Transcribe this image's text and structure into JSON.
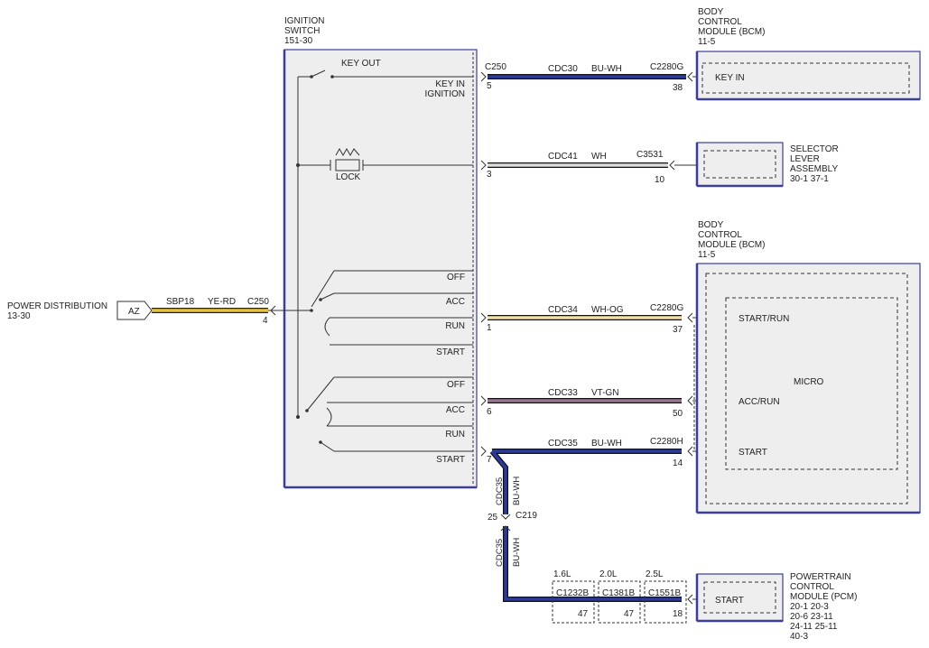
{
  "ignition_switch": {
    "title_lines": [
      "IGNITION",
      "SWITCH",
      "151-30"
    ],
    "key_out": "KEY OUT",
    "key_in_lines": [
      "KEY IN",
      "IGNITION"
    ],
    "lock": "LOCK",
    "bank1": [
      "OFF",
      "ACC",
      "RUN",
      "START"
    ],
    "bank2": [
      "OFF",
      "ACC",
      "RUN",
      "START"
    ]
  },
  "power_distribution": {
    "title_lines": [
      "POWER DISTRIBUTION",
      "13-30"
    ],
    "fuse": "AZ",
    "circuit": "SBP18",
    "color": "YE-RD",
    "connector": "C250",
    "pin": "4"
  },
  "wires": [
    {
      "id": "w1",
      "circuit": "CDC30",
      "color": "BU-WH",
      "left_conn": "C250",
      "left_pin": "5",
      "right_conn": "C2280G",
      "right_pin": "38",
      "stroke": "#2b3a9e"
    },
    {
      "id": "w2",
      "circuit": "CDC41",
      "color": "WH",
      "left_conn": "",
      "left_pin": "3",
      "right_conn": "C3531",
      "right_pin": "10",
      "stroke": "#dddddd"
    },
    {
      "id": "w3",
      "circuit": "CDC34",
      "color": "WH-OG",
      "left_conn": "",
      "left_pin": "1",
      "right_conn": "C2280G",
      "right_pin": "37",
      "stroke": "#f2dfa8"
    },
    {
      "id": "w4",
      "circuit": "CDC33",
      "color": "VT-GN",
      "left_conn": "",
      "left_pin": "6",
      "right_conn": "",
      "right_pin": "50",
      "stroke": "#9a7590"
    },
    {
      "id": "w5",
      "circuit": "CDC35",
      "color": "BU-WH",
      "left_conn": "",
      "left_pin": "7",
      "right_conn": "C2280H",
      "right_pin": "14",
      "stroke": "#2b3a9e"
    }
  ],
  "c219": {
    "label": "C219",
    "pin": "25",
    "circuit": "CDC35",
    "color": "BU-WH"
  },
  "bcm_top": {
    "title_lines": [
      "BODY",
      "CONTROL",
      "MODULE (BCM)",
      "11-5"
    ],
    "pin_label": "KEY IN"
  },
  "selector": {
    "title_lines": [
      "SELECTOR",
      "LEVER",
      "ASSEMBLY",
      "30-1   37-1"
    ]
  },
  "bcm_bottom": {
    "title_lines": [
      "BODY",
      "CONTROL",
      "MODULE (BCM)",
      "11-5"
    ],
    "micro": "MICRO",
    "start_run": "START/RUN",
    "acc_run": "ACC/RUN",
    "start": "START"
  },
  "pcm": {
    "title_lines": [
      "POWERTRAIN",
      "CONTROL",
      "MODULE (PCM)",
      "20-1   20-3",
      "20-6   23-11",
      "24-11   25-11",
      "40-3"
    ],
    "pin_label": "START"
  },
  "engine_variants": [
    {
      "engine": "1.6L",
      "connector": "C1232B",
      "pin": "47"
    },
    {
      "engine": "2.0L",
      "connector": "C1381B",
      "pin": "47"
    },
    {
      "engine": "2.5L",
      "connector": "C1551B",
      "pin": "18"
    }
  ]
}
